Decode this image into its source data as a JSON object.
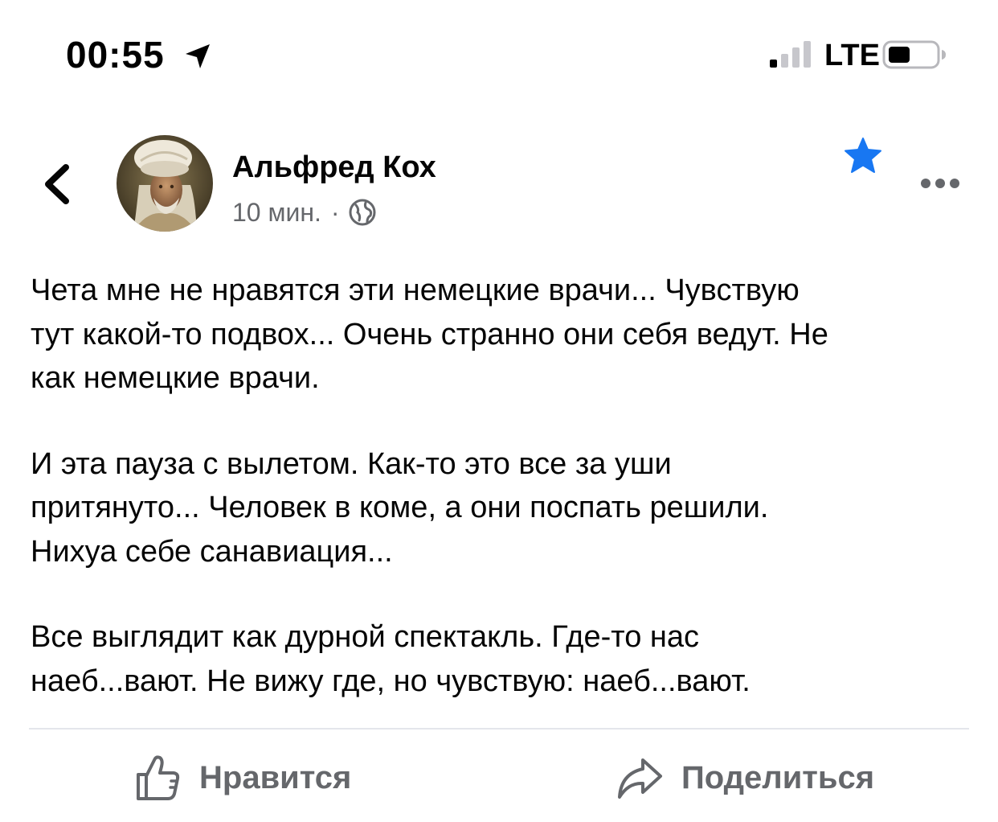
{
  "status_bar": {
    "time": "00:55",
    "network": "LTE",
    "icons": [
      "location-arrow-icon",
      "signal-icon",
      "battery-icon"
    ]
  },
  "post": {
    "author": "Альфред Кох",
    "time": "10 мин.",
    "separator": "·",
    "privacy_icon": "globe-icon",
    "paragraphs": [
      "Чета мне не нравятся эти немецкие врачи... Чувствую\nтут какой-то подвох... Очень странно они себя ведут. Не\nкак немецкие врачи.",
      "И эта пауза с вылетом. Как-то это все за уши\nпритянуто... Человек в коме, а они поспать решили.\nНихуа себе санавиация...",
      "Все выглядит как дурной спектакль. Где-то нас\nнаеб...вают. Не вижу где, но чувствую: наеб...вают."
    ]
  },
  "actions": {
    "like_label": "Нравится",
    "share_label": "Поделиться"
  },
  "colors": {
    "text": "#050505",
    "secondary_text": "#65676b",
    "accent_blue": "#1877f2",
    "divider": "#e4e6eb"
  }
}
